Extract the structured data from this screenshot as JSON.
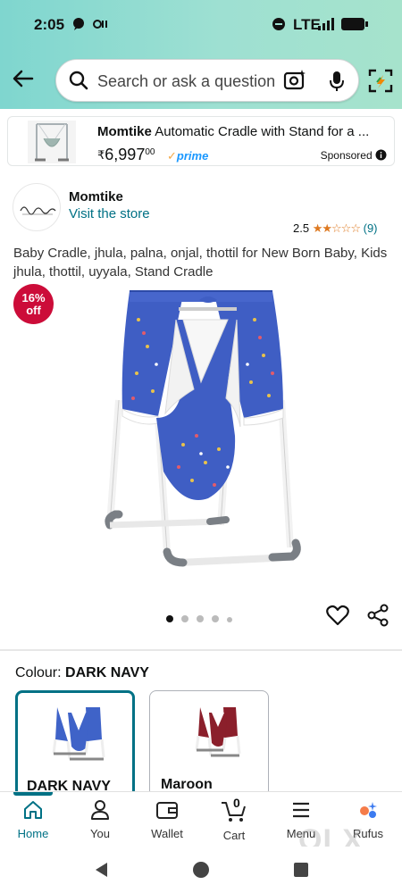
{
  "status_bar": {
    "time": "2:05",
    "network": "LTE"
  },
  "search": {
    "placeholder": "Search or ask a question"
  },
  "sponsored_ad": {
    "brand": "Momtike",
    "title": "Automatic Cradle with Stand for a ...",
    "currency": "₹",
    "price_whole": "6,997",
    "price_fraction": "00",
    "prime_label": "prime",
    "sponsored_label": "Sponsored"
  },
  "brand": {
    "name": "Momtike",
    "visit_label": "Visit the store"
  },
  "rating": {
    "score": "2.5",
    "stars": "★★☆☆☆",
    "count": "(9)"
  },
  "product": {
    "title": "Baby Cradle, jhula, palna, onjal, thottil for New Born Baby, Kids jhula, thottil, uyyala, Stand Cradle",
    "discount_line1": "16%",
    "discount_line2": "off",
    "image_count": 5,
    "active_image": 1
  },
  "colour": {
    "label": "Colour:",
    "selected": "DARK NAVY",
    "options": [
      {
        "name": "DARK NAVY",
        "color": "#3f63c8"
      },
      {
        "name": "Maroon",
        "color": "#8b1f2b"
      }
    ]
  },
  "bottom_nav": {
    "items": [
      {
        "label": "Home",
        "icon": "home-icon"
      },
      {
        "label": "You",
        "icon": "person-icon"
      },
      {
        "label": "Wallet",
        "icon": "wallet-icon"
      },
      {
        "label": "Cart",
        "icon": "cart-icon",
        "badge": "0"
      },
      {
        "label": "Menu",
        "icon": "menu-icon"
      },
      {
        "label": "Rufus",
        "icon": "rufus-icon"
      }
    ]
  },
  "watermark": "OLX",
  "colors": {
    "accent": "#007185",
    "deal": "#cc0c39",
    "star": "#de7921",
    "prime": "#1a98ff"
  }
}
